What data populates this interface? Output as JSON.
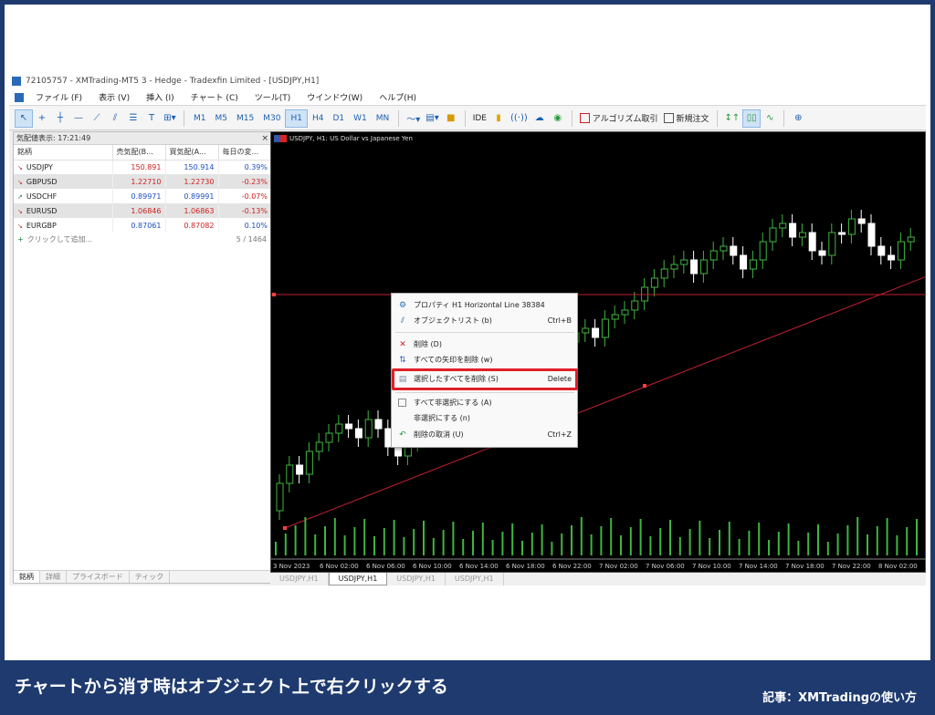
{
  "window": {
    "title": "72105757 - XMTrading-MT5 3 - Hedge - Tradexfin Limited - [USDJPY,H1]"
  },
  "menu": [
    "ファイル (F)",
    "表示 (V)",
    "挿入 (I)",
    "チャート (C)",
    "ツール(T)",
    "ウインドウ(W)",
    "ヘルプ(H)"
  ],
  "toolbar": {
    "timeframes": [
      "M1",
      "M5",
      "M15",
      "M30",
      "H1",
      "H4",
      "D1",
      "W1",
      "MN"
    ],
    "active_timeframe": "H1",
    "ide_label": "IDE",
    "algo_label": "アルゴリズム取引",
    "new_order_label": "新規注文",
    "text_tool": "T"
  },
  "market_watch": {
    "header": "気配値表示: 17:21:49",
    "columns": [
      "銘柄",
      "売気配(B...",
      "買気配(A...",
      "毎日の変..."
    ],
    "rows": [
      {
        "symbol": "USDJPY",
        "bid": "150.891",
        "ask": "150.914",
        "change": "0.39%",
        "dir": "down"
      },
      {
        "symbol": "GBPUSD",
        "bid": "1.22710",
        "ask": "1.22730",
        "change": "-0.23%",
        "dir": "down"
      },
      {
        "symbol": "USDCHF",
        "bid": "0.89971",
        "ask": "0.89991",
        "change": "-0.07%",
        "dir": "up"
      },
      {
        "symbol": "EURUSD",
        "bid": "1.06846",
        "ask": "1.06863",
        "change": "-0.13%",
        "dir": "down"
      },
      {
        "symbol": "EURGBP",
        "bid": "0.87061",
        "ask": "0.87082",
        "change": "0.10%",
        "dir": "up"
      }
    ],
    "add_label": "クリックして追加...",
    "count": "5 / 1464",
    "tabs": [
      "銘柄",
      "詳細",
      "プライスボード",
      "ティック"
    ]
  },
  "chart": {
    "header": "USDJPY, H1: US Dollar vs Japanese Yen",
    "time_labels": [
      "3 Nov 2023",
      "6 Nov 02:00",
      "6 Nov 06:00",
      "6 Nov 10:00",
      "6 Nov 14:00",
      "6 Nov 18:00",
      "6 Nov 22:00",
      "7 Nov 02:00",
      "7 Nov 06:00",
      "7 Nov 10:00",
      "7 Nov 14:00",
      "7 Nov 18:00",
      "7 Nov 22:00",
      "8 Nov 02:00"
    ],
    "tabs": [
      "USDJPY,H1",
      "USDJPY,H1",
      "USDJPY,H1",
      "USDJPY,H1"
    ],
    "active_tab": 1
  },
  "context_menu": {
    "items": [
      {
        "label": "プロパティ H1 Horizontal Line 38384",
        "shortcut": "",
        "icon": "gear-icon"
      },
      {
        "label": "オブジェクトリスト (b)",
        "shortcut": "Ctrl+B",
        "icon": "object-list-icon"
      },
      {
        "label": "削除 (D)",
        "shortcut": "",
        "icon": "delete-x-icon"
      },
      {
        "label": "すべての矢印を削除 (w)",
        "shortcut": "",
        "icon": "arrows-icon"
      },
      {
        "label": "選択したすべてを削除 (S)",
        "shortcut": "Delete",
        "icon": "delete-selected-icon"
      },
      {
        "label": "すべて非選択にする (A)",
        "shortcut": "",
        "icon": "checkbox-icon"
      },
      {
        "label": "非選択にする (n)",
        "shortcut": "",
        "icon": ""
      },
      {
        "label": "削除の取消 (U)",
        "shortcut": "Ctrl+Z",
        "icon": "undo-icon"
      }
    ],
    "highlight_color": "#e0202a"
  },
  "caption": {
    "main": "チャートから消す時はオブジェクト上で右クリックする",
    "source": "記事：XMTradingの使い方"
  },
  "colors": {
    "frame_bg": "#1e3a6e",
    "bull": "#3fb53f",
    "bear": "#ffffff",
    "trend_line": "#c02030"
  }
}
